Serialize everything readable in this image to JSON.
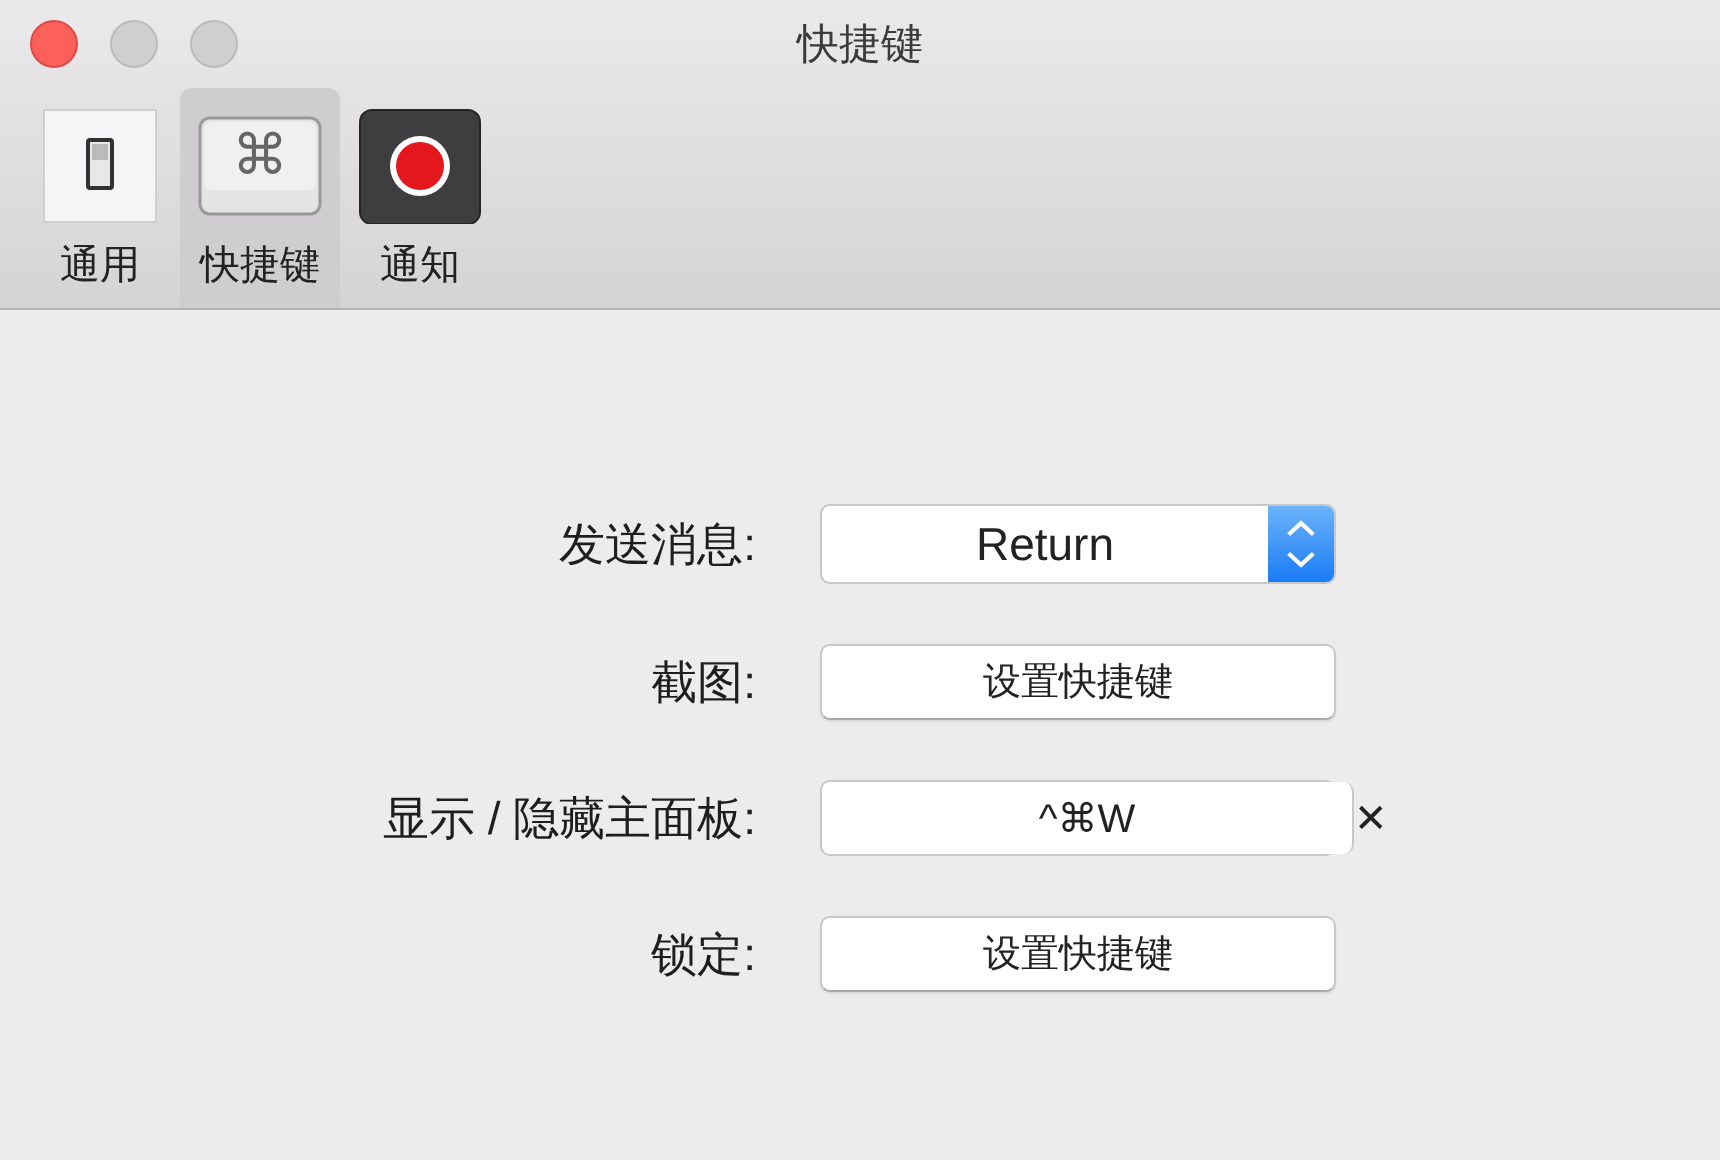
{
  "window": {
    "title": "快捷键"
  },
  "toolbar": {
    "items": [
      {
        "label": "通用",
        "kind": "switch",
        "selected": false
      },
      {
        "label": "快捷键",
        "kind": "keycap",
        "glyph": "⌘",
        "selected": true
      },
      {
        "label": "通知",
        "kind": "record",
        "selected": false
      }
    ]
  },
  "rows": [
    {
      "label": "发送消息:",
      "kind": "popup",
      "value": "Return"
    },
    {
      "label": "截图:",
      "kind": "button",
      "value": "设置快捷键"
    },
    {
      "label": "显示 / 隐藏主面板:",
      "kind": "shortcut",
      "value": "^⌘W",
      "clear": "✕"
    },
    {
      "label": "锁定:",
      "kind": "button",
      "value": "设置快捷键"
    }
  ]
}
